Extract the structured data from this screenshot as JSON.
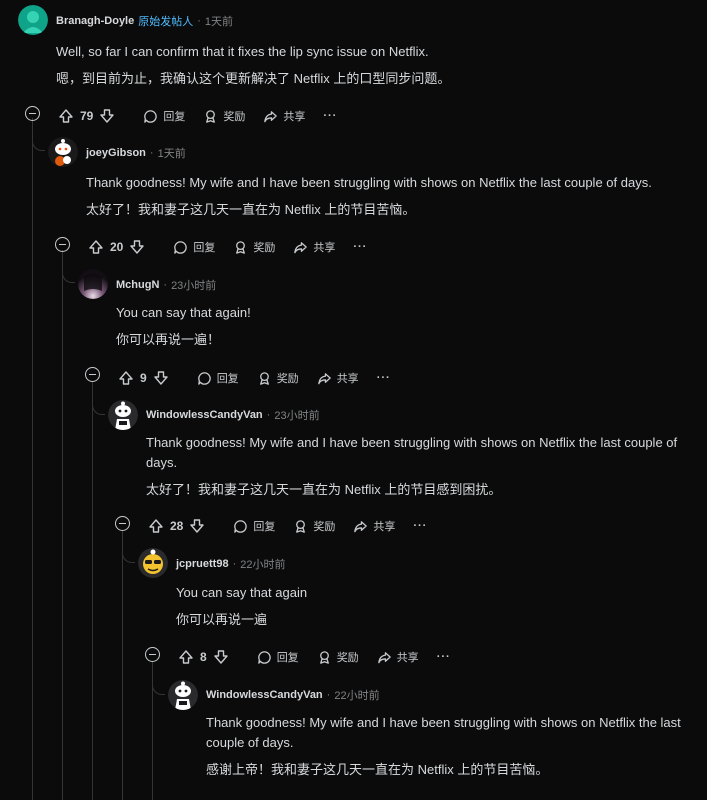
{
  "labels": {
    "reply": "回复",
    "award": "奖励",
    "share": "共享",
    "more": "···"
  },
  "comments": [
    {
      "author": "Branagh-Doyle",
      "badge": "原始发帖人",
      "time": "1天前",
      "text_en": "Well, so far I can confirm that it fixes the lip sync issue on Netflix.",
      "text_zh": "嗯，到目前为止，我确认这个更新解决了 Netflix 上的口型同步问题。",
      "score": "79"
    },
    {
      "author": "joeyGibson",
      "time": "1天前",
      "text_en": "Thank goodness! My wife and I have been struggling with shows on Netflix the last couple of days.",
      "text_zh": "太好了！我和妻子这几天一直在为 Netflix 上的节目苦恼。",
      "score": "20"
    },
    {
      "author": "MchugN",
      "time": "23小时前",
      "text_en": "You can say that again!",
      "text_zh": "你可以再说一遍！",
      "score": "9"
    },
    {
      "author": "WindowlessCandyVan",
      "time": "23小时前",
      "text_en": "Thank goodness! My wife and I have been struggling with shows on Netflix the last couple of days.",
      "text_zh": "太好了！我和妻子这几天一直在为 Netflix 上的节目感到困扰。",
      "score": "28"
    },
    {
      "author": "jcpruett98",
      "time": "22小时前",
      "text_en": "You can say that again",
      "text_zh": "你可以再说一遍",
      "score": "8"
    },
    {
      "author": "WindowlessCandyVan",
      "time": "22小时前",
      "text_en": "Thank goodness! My wife and I have been struggling with shows on Netflix the last couple of days.",
      "text_zh": "感谢上帝！我和妻子这几天一直在为 Netflix 上的节目苦恼。"
    }
  ]
}
